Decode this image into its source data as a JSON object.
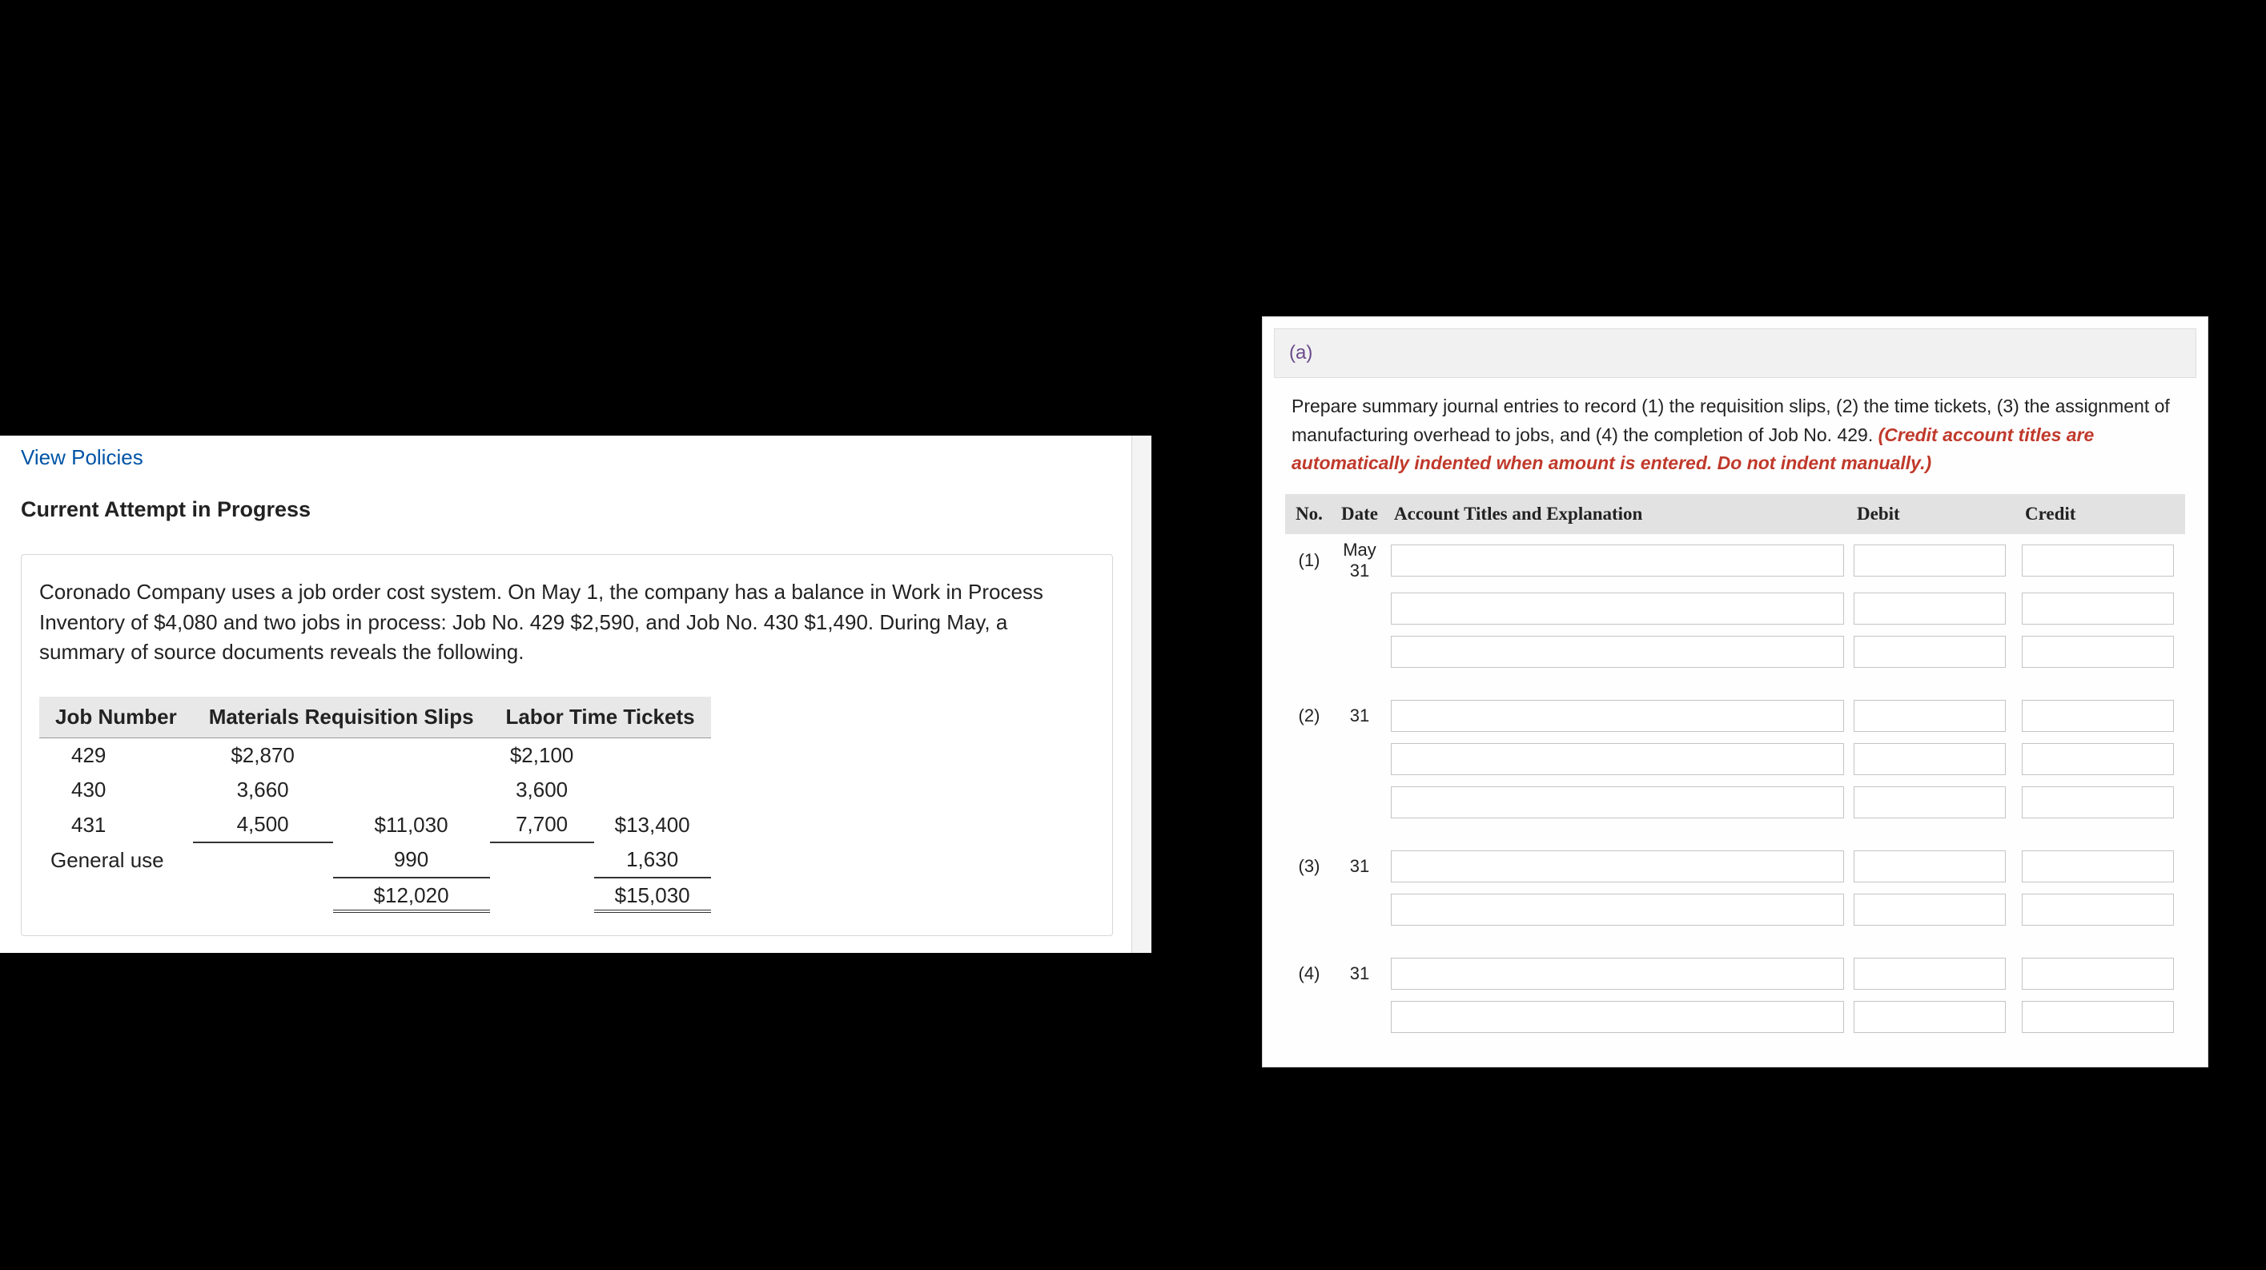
{
  "left": {
    "view_policies": "View Policies",
    "heading": "Current Attempt in Progress",
    "problem_text": "Coronado Company uses a job order cost system. On May 1, the company has a balance in Work in Process Inventory of $4,080 and two jobs in process: Job No. 429 $2,590, and Job No. 430 $1,490. During May, a summary of source documents reveals the following.",
    "table": {
      "headers": {
        "job_number": "Job Number",
        "materials": "Materials Requisition Slips",
        "labor": "Labor Time Tickets"
      },
      "rows": [
        {
          "job": "429",
          "mat": "$2,870",
          "mat_sub": "",
          "lab": "$2,100",
          "lab_sub": ""
        },
        {
          "job": "430",
          "mat": "3,660",
          "mat_sub": "",
          "lab": "3,600",
          "lab_sub": ""
        },
        {
          "job": "431",
          "mat": "4,500",
          "mat_sub": "$11,030",
          "lab": "7,700",
          "lab_sub": "$13,400"
        },
        {
          "job": "General use",
          "mat": "",
          "mat_sub": "990",
          "lab": "",
          "lab_sub": "1,630"
        }
      ],
      "totals": {
        "mat": "$12,020",
        "lab": "$15,030"
      }
    }
  },
  "right": {
    "part_label": "(a)",
    "instructions_plain": "Prepare summary journal entries to record (1) the requisition slips, (2) the time tickets, (3) the assignment of manufacturing overhead to jobs, and (4) the completion of Job No. 429. ",
    "instructions_red": "(Credit account titles are automatically indented when amount is entered. Do not indent manually.)",
    "journal_headers": {
      "no": "No.",
      "date": "Date",
      "account": "Account Titles and Explanation",
      "debit": "Debit",
      "credit": "Credit"
    },
    "entries": [
      {
        "no": "(1)",
        "date": "May 31",
        "lines": 3
      },
      {
        "no": "(2)",
        "date": "31",
        "lines": 3
      },
      {
        "no": "(3)",
        "date": "31",
        "lines": 2
      },
      {
        "no": "(4)",
        "date": "31",
        "lines": 2
      }
    ]
  }
}
